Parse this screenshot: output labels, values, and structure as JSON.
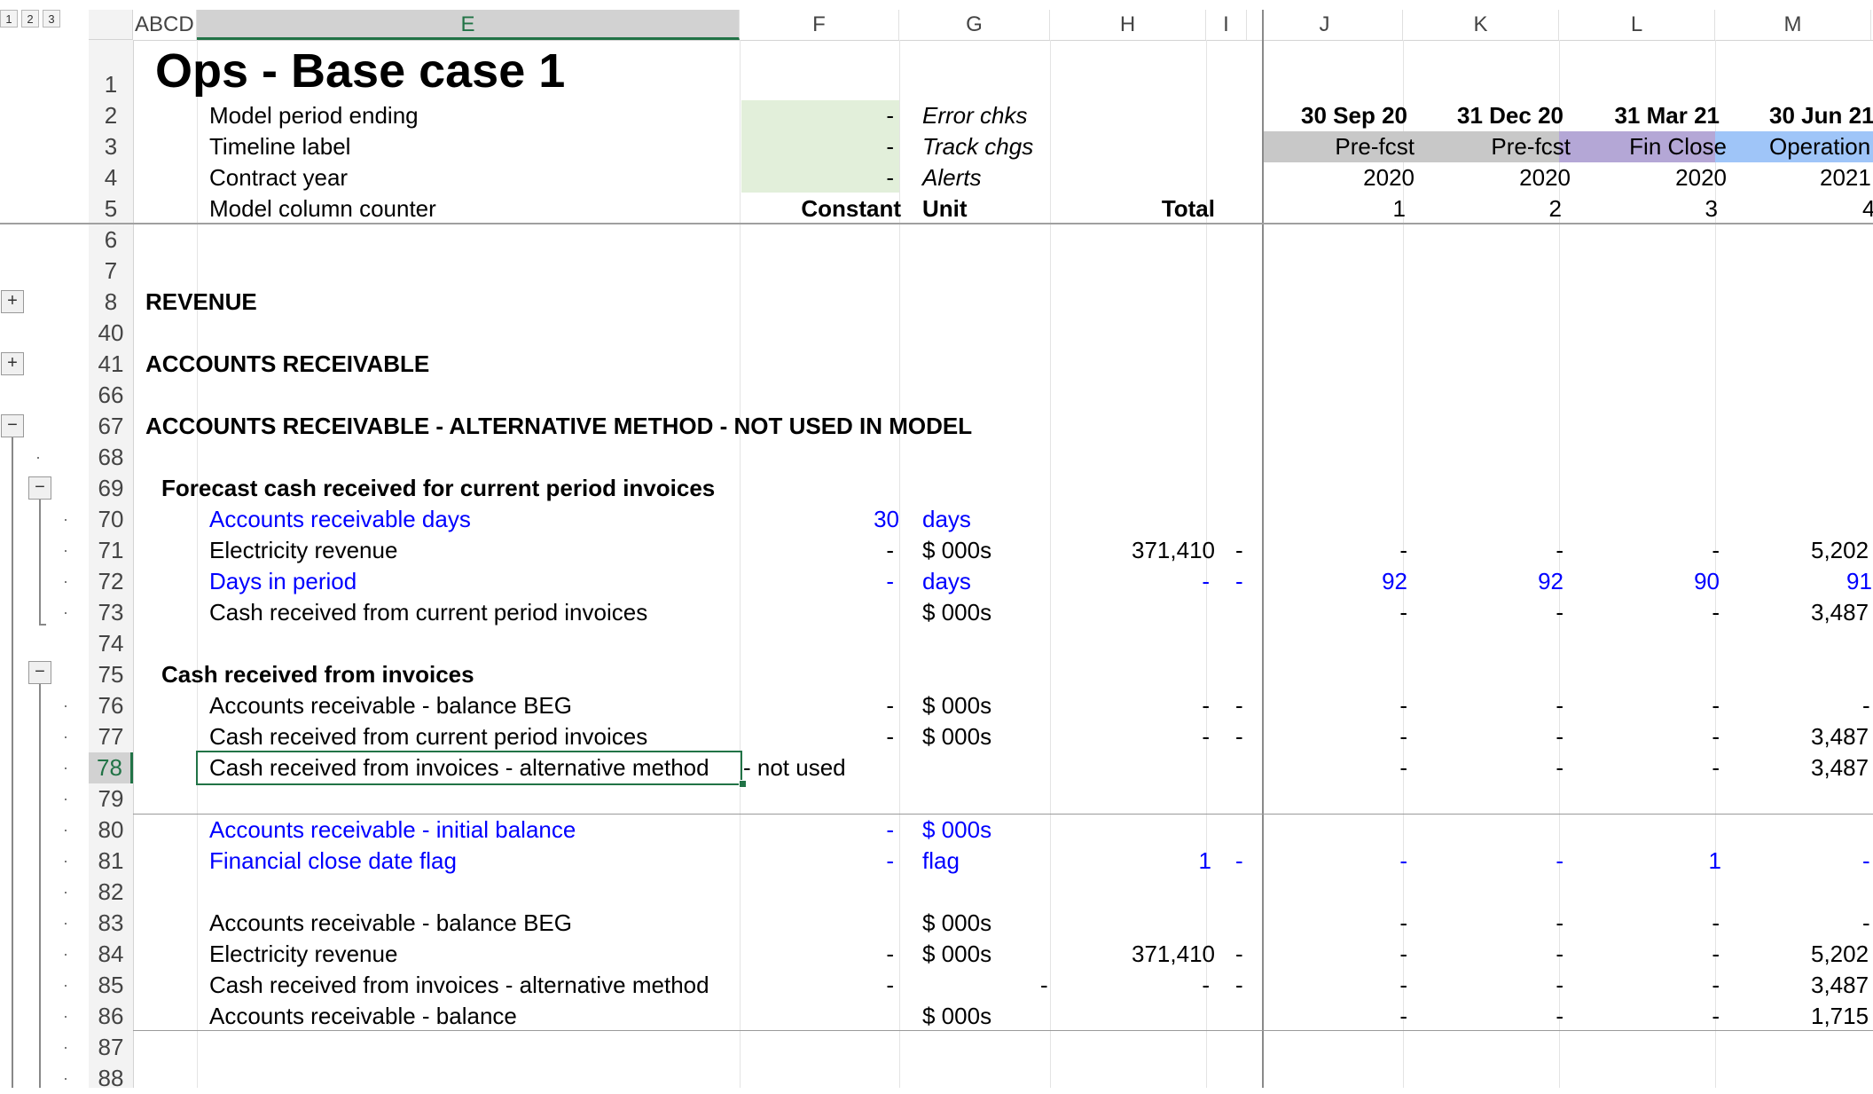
{
  "outline_levels": [
    "1",
    "2",
    "3"
  ],
  "columns": [
    {
      "id": "ABCD",
      "label": "ABCD"
    },
    {
      "id": "E",
      "label": "E"
    },
    {
      "id": "F",
      "label": "F"
    },
    {
      "id": "G",
      "label": "G"
    },
    {
      "id": "H",
      "label": "H"
    },
    {
      "id": "I",
      "label": "I"
    },
    {
      "id": "J",
      "label": "J"
    },
    {
      "id": "K",
      "label": "K"
    },
    {
      "id": "L",
      "label": "L"
    },
    {
      "id": "M",
      "label": "M"
    }
  ],
  "selected_column": "E",
  "selected_row": "78",
  "title": "Ops - Base case 1",
  "header_rows": {
    "r2": {
      "label": "Model period ending",
      "f": "-",
      "g": "Error chks"
    },
    "r3": {
      "label": "Timeline label",
      "f": "-",
      "g": "Track chgs"
    },
    "r4": {
      "label": "Contract year",
      "f": "-",
      "g": "Alerts"
    },
    "r5": {
      "label": "Model column counter",
      "f": "Constant",
      "g": "Unit",
      "h": "Total"
    }
  },
  "periods": [
    {
      "date": "30 Sep 20",
      "label": "Pre-fcst",
      "year": "2020",
      "counter": "1",
      "color": "#c8c8c8"
    },
    {
      "date": "31 Dec 20",
      "label": "Pre-fcst",
      "year": "2020",
      "counter": "2",
      "color": "#c8c8c8"
    },
    {
      "date": "31 Mar 21",
      "label": "Fin Close",
      "year": "2020",
      "counter": "3",
      "color": "#b4a7d6"
    },
    {
      "date": "30 Jun 21",
      "label": "Operation",
      "year": "2021",
      "counter": "4",
      "color": "#9fc5f8"
    }
  ],
  "row_numbers": [
    "1",
    "2",
    "3",
    "4",
    "5",
    "6",
    "7",
    "8",
    "40",
    "41",
    "66",
    "67",
    "68",
    "69",
    "70",
    "71",
    "72",
    "73",
    "74",
    "75",
    "76",
    "77",
    "78",
    "79",
    "80",
    "81",
    "82",
    "83",
    "84",
    "85",
    "86",
    "87",
    "88"
  ],
  "sections": {
    "revenue": "REVENUE",
    "ar": "ACCOUNTS RECEIVABLE",
    "ar_alt": "ACCOUNTS RECEIVABLE - ALTERNATIVE METHOD - NOT USED IN MODEL",
    "forecast": "Forecast cash received for current period invoices",
    "cash_inv": "Cash received from invoices"
  },
  "rows": {
    "r70": {
      "label": "Accounts receivable days",
      "f": "30",
      "g": "days",
      "blue": true
    },
    "r71": {
      "label": "Electricity revenue",
      "f": "-",
      "g": "$ 000s",
      "h": "371,410",
      "i": "-",
      "j": "-",
      "k": "-",
      "l": "-",
      "m": "5,202"
    },
    "r72": {
      "label": "Days in period",
      "f": "-",
      "g": "days",
      "h": "-",
      "i": "-",
      "j": "92",
      "k": "92",
      "l": "90",
      "m": "91"
    },
    "r73": {
      "label": "Cash received from current period invoices",
      "g": "$ 000s",
      "j": "-",
      "k": "-",
      "l": "-",
      "m": "3,487"
    },
    "r76": {
      "label": "Accounts receivable - balance BEG",
      "f": "-",
      "g": "$ 000s",
      "h": "-",
      "i": "-",
      "j": "-",
      "k": "-",
      "l": "-",
      "m": "-"
    },
    "r77": {
      "label": "Cash received from current period invoices",
      "f": "-",
      "g": "$ 000s",
      "h": "-",
      "i": "-",
      "j": "-",
      "k": "-",
      "l": "-",
      "m": "3,487"
    },
    "r78": {
      "label": "Cash received from invoices - alternative method",
      "overflow": "- not used",
      "j": "-",
      "k": "-",
      "l": "-",
      "m": "3,487"
    },
    "r80": {
      "label": "Accounts receivable - initial balance",
      "f": "-",
      "g": "$ 000s"
    },
    "r81": {
      "label": "Financial close date flag",
      "f": "-",
      "g": "flag",
      "h": "1",
      "i": "-",
      "j": "-",
      "k": "-",
      "l": "1",
      "m": "-"
    },
    "r83": {
      "label": "Accounts receivable - balance BEG",
      "g": "$ 000s",
      "j": "-",
      "k": "-",
      "l": "-",
      "m": "-"
    },
    "r84": {
      "label": "Electricity revenue",
      "f": "-",
      "g": "$ 000s",
      "h": "371,410",
      "i": "-",
      "j": "-",
      "k": "-",
      "l": "-",
      "m": "5,202"
    },
    "r85": {
      "label": "Cash received from invoices - alternative method",
      "f": "-",
      "gh": "-",
      "h": "-",
      "i": "-",
      "j": "-",
      "k": "-",
      "l": "-",
      "m": "3,487"
    },
    "r86": {
      "label": "Accounts receivable - balance",
      "g": "$ 000s",
      "j": "-",
      "k": "-",
      "l": "-",
      "m": "1,715"
    }
  },
  "outline_buttons": {
    "expand": "+",
    "collapse": "−"
  }
}
